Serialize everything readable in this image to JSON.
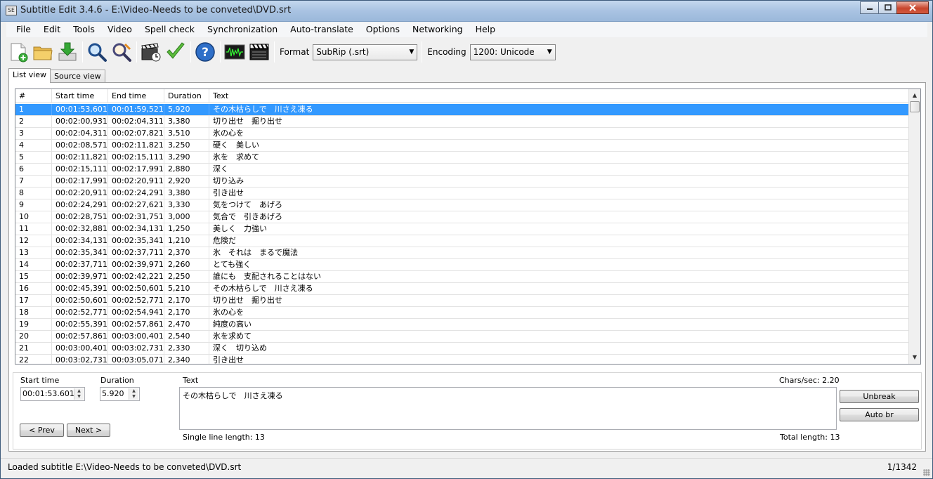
{
  "window": {
    "title": "Subtitle Edit 3.4.6 - E:\\Video-Needs to be conveted\\DVD.srt",
    "icon_text": "SE"
  },
  "menu": [
    "File",
    "Edit",
    "Tools",
    "Video",
    "Spell check",
    "Synchronization",
    "Auto-translate",
    "Options",
    "Networking",
    "Help"
  ],
  "toolbar": {
    "icons": [
      "new-file-icon",
      "open-folder-icon",
      "download-icon",
      "find-icon",
      "replace-icon",
      "visual-sync-icon",
      "spell-check-icon",
      "help-icon",
      "waveform-icon",
      "video-clapper-icon"
    ],
    "format_label": "Format",
    "format_value": "SubRip (.srt)",
    "encoding_label": "Encoding",
    "encoding_value": "1200: Unicode"
  },
  "tabs": [
    "List view",
    "Source view"
  ],
  "grid": {
    "columns": [
      "#",
      "Start time",
      "End time",
      "Duration",
      "Text"
    ],
    "rows": [
      [
        "1",
        "00:01:53,601",
        "00:01:59,521",
        "5,920",
        "その木枯らしで　川さえ凍る"
      ],
      [
        "2",
        "00:02:00,931",
        "00:02:04,311",
        "3,380",
        "切り出せ　掘り出せ"
      ],
      [
        "3",
        "00:02:04,311",
        "00:02:07,821",
        "3,510",
        "氷の心を"
      ],
      [
        "4",
        "00:02:08,571",
        "00:02:11,821",
        "3,250",
        "硬く　美しい"
      ],
      [
        "5",
        "00:02:11,821",
        "00:02:15,111",
        "3,290",
        "氷を　求めて"
      ],
      [
        "6",
        "00:02:15,111",
        "00:02:17,991",
        "2,880",
        "深く"
      ],
      [
        "7",
        "00:02:17,991",
        "00:02:20,911",
        "2,920",
        "切り込み"
      ],
      [
        "8",
        "00:02:20,911",
        "00:02:24,291",
        "3,380",
        "引き出せ"
      ],
      [
        "9",
        "00:02:24,291",
        "00:02:27,621",
        "3,330",
        "気をつけて　あげろ"
      ],
      [
        "10",
        "00:02:28,751",
        "00:02:31,751",
        "3,000",
        "気合で　引きあげろ"
      ],
      [
        "11",
        "00:02:32,881",
        "00:02:34,131",
        "1,250",
        "美しく　力強い"
      ],
      [
        "12",
        "00:02:34,131",
        "00:02:35,341",
        "1,210",
        "危険だ"
      ],
      [
        "13",
        "00:02:35,341",
        "00:02:37,711",
        "2,370",
        "氷　それは　まるで魔法"
      ],
      [
        "14",
        "00:02:37,711",
        "00:02:39,971",
        "2,260",
        "とても強く"
      ],
      [
        "15",
        "00:02:39,971",
        "00:02:42,221",
        "2,250",
        "誰にも　支配されることはない"
      ],
      [
        "16",
        "00:02:45,391",
        "00:02:50,601",
        "5,210",
        "その木枯らしで　川さえ凍る"
      ],
      [
        "17",
        "00:02:50,601",
        "00:02:52,771",
        "2,170",
        "切り出せ　掘り出せ"
      ],
      [
        "18",
        "00:02:52,771",
        "00:02:54,941",
        "2,170",
        "氷の心を"
      ],
      [
        "19",
        "00:02:55,391",
        "00:02:57,861",
        "2,470",
        "純度の高い"
      ],
      [
        "20",
        "00:02:57,861",
        "00:03:00,401",
        "2,540",
        "氷を求めて"
      ],
      [
        "21",
        "00:03:00,401",
        "00:03:02,731",
        "2,330",
        "深く　切り込め"
      ],
      [
        "22",
        "00:03:02,731",
        "00:03:05,071",
        "2,340",
        "引き出せ"
      ]
    ]
  },
  "editor": {
    "start_time_label": "Start time",
    "start_time_value": "00:01:53.601",
    "duration_label": "Duration",
    "duration_value": "5.920",
    "text_label": "Text",
    "text_value": "その木枯らしで　川さえ凍る",
    "chars_sec": "Chars/sec: 2.20",
    "single_line_length": "Single line length: 13",
    "total_length": "Total length: 13",
    "prev_label": "< Prev",
    "next_label": "Next >",
    "unbreak_label": "Unbreak",
    "auto_br_label": "Auto br"
  },
  "status": {
    "message": "Loaded subtitle E:\\Video-Needs to be conveted\\DVD.srt",
    "position": "1/1342"
  }
}
